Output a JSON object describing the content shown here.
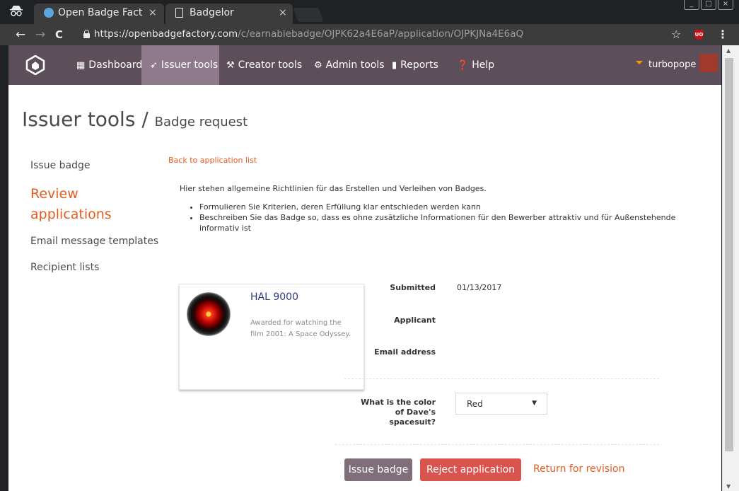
{
  "browser": {
    "tabs": [
      {
        "title": "Open Badge Factor",
        "close": "×"
      },
      {
        "title": "Badgelor",
        "close": "×"
      }
    ],
    "address": {
      "host": "https://openbadgefactory.com",
      "path": "/c/earnablebadge/OJPK62a4E6aP/application/OJPKJNa4E6aQ"
    },
    "nav": {
      "back": "←",
      "forward": "→",
      "reload": "C"
    },
    "extensions": {
      "star": "☆",
      "ublock": "UO",
      "menu": "⋮"
    }
  },
  "site": {
    "nav_items": [
      {
        "label": "Dashboard",
        "icon": "dashboard-icon"
      },
      {
        "label": "Issuer tools",
        "icon": "send-icon"
      },
      {
        "label": "Creator tools",
        "icon": "wrench-icon"
      },
      {
        "label": "Admin tools",
        "icon": "gear-icon"
      },
      {
        "label": "Reports",
        "icon": "bar-chart-icon"
      },
      {
        "label": "Help",
        "icon": "help-icon"
      }
    ],
    "user": "turbopope"
  },
  "page": {
    "title": "Issuer tools /",
    "subtitle": "Badge request",
    "sidebar": [
      "Issue badge",
      "Review applications",
      "Email message templates",
      "Recipient lists"
    ],
    "back_link": "Back to application list",
    "guidelines": "Hier stehen allgemeine Richtlinien für das Erstellen und Verleihen von Badges.",
    "bullets": [
      "Formulieren Sie Kriterien, deren Erfüllung klar entschieden werden kann",
      "Beschreiben Sie das Badge so, dass es ohne zusätzliche Informationen für den Bewerber attraktiv und für Außenstehende informativ ist"
    ],
    "badge": {
      "name": "HAL 9000",
      "description": "Awarded for watching the film 2001: A Space Odyssey."
    },
    "fields": {
      "submitted_label": "Submitted",
      "submitted_value": "01/13/2017",
      "applicant_label": "Applicant",
      "email_label": "Email address",
      "question": "What is the color of Dave's spacesuit?",
      "answer": "Red"
    },
    "actions": {
      "issue": "Issue badge",
      "reject": "Reject application",
      "revise": "Return for revision"
    }
  },
  "colors": {
    "accent": "#e65c1f",
    "navbar": "#5d4f5a",
    "danger": "#d9534f"
  }
}
